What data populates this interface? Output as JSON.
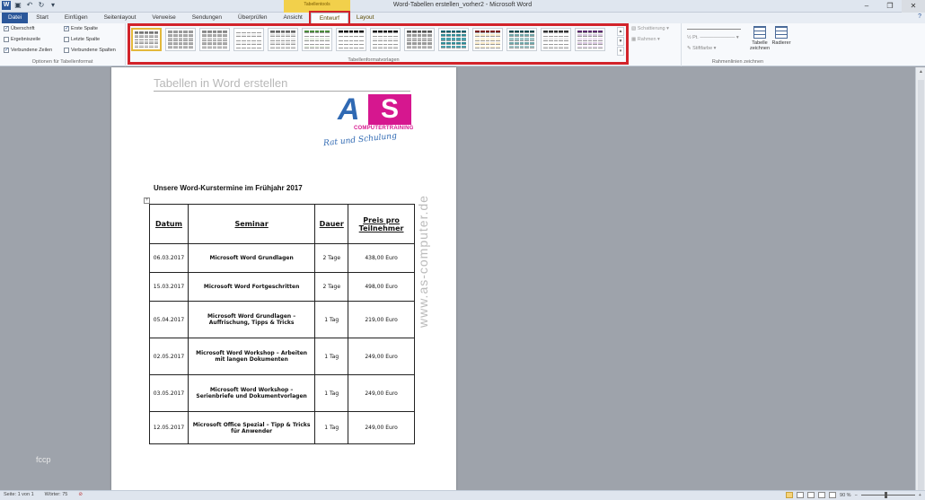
{
  "window": {
    "title": "Word-Tabellen erstellen_vorher2 - Microsoft Word",
    "context_title": "Tabellentools"
  },
  "tabs": [
    {
      "label": "Datei"
    },
    {
      "label": "Start"
    },
    {
      "label": "Einfügen"
    },
    {
      "label": "Seitenlayout"
    },
    {
      "label": "Verweise"
    },
    {
      "label": "Sendungen"
    },
    {
      "label": "Überprüfen"
    },
    {
      "label": "Ansicht"
    },
    {
      "label": "Entwurf"
    },
    {
      "label": "Layout"
    }
  ],
  "ribbon": {
    "options": {
      "items": [
        {
          "label": "Überschrift",
          "checked": true
        },
        {
          "label": "Ergebniszeile",
          "checked": false
        },
        {
          "label": "Verbundene Zeilen",
          "checked": true
        },
        {
          "label": "Erste Spalte",
          "checked": true
        },
        {
          "label": "Letzte Spalte",
          "checked": false
        },
        {
          "label": "Verbundene Spalten",
          "checked": false
        }
      ],
      "group_label": "Optionen für Tabellenformat"
    },
    "styles_group_label": "Tabellenformatvorlagen",
    "shading_label": "Schattierung",
    "borders_label": "Rahmen",
    "pen_width": "½ Pt.",
    "pen_color_label": "Stiftfarbe",
    "draw_table_label": "Tabelle zeichnen",
    "eraser_label": "Radierer",
    "borders_group_label": "Rahmenlinien zeichnen"
  },
  "document": {
    "header": "Tabellen in Word erstellen",
    "logo": {
      "letters": "AS",
      "company": "COMPUTERTRAINING",
      "slogan": "Rat und Schulung"
    },
    "section_title": "Unsere Word-Kurstermine im Frühjahr 2017",
    "watermark": "www.as-computer.de",
    "corner_text": "fccp",
    "table": {
      "headers": [
        "Datum",
        "Seminar",
        "Dauer",
        "Preis pro Teilnehmer"
      ],
      "rows": [
        [
          "06.03.2017",
          "Microsoft Word Grundlagen",
          "2 Tage",
          "438,00 Euro"
        ],
        [
          "15.03.2017",
          "Microsoft Word Fortgeschritten",
          "2 Tage",
          "498,00 Euro"
        ],
        [
          "05.04.2017",
          "Microsoft Word Grundlagen – Auffrischung, Tipps & Tricks",
          "1 Tag",
          "219,00 Euro"
        ],
        [
          "02.05.2017",
          "Microsoft Word Workshop – Arbeiten mit langen Dokumenten",
          "1 Tag",
          "249,00 Euro"
        ],
        [
          "03.05.2017",
          "Microsoft Word Workshop – Serienbriefe und Dokumentvorlagen",
          "1 Tag",
          "249,00 Euro"
        ],
        [
          "12.05.2017",
          "Microsoft Office Spezial – Tipp & Tricks für Anwender",
          "1 Tag",
          "249,00 Euro"
        ]
      ]
    }
  },
  "status": {
    "page": "Seite: 1 von 1",
    "words": "Wörter: 75",
    "zoom": "90 %"
  },
  "colors": {
    "accent": "#2b579a",
    "highlight_frame": "#d2232a",
    "logo_blue": "#2f69b3",
    "logo_magenta": "#d6178f"
  }
}
